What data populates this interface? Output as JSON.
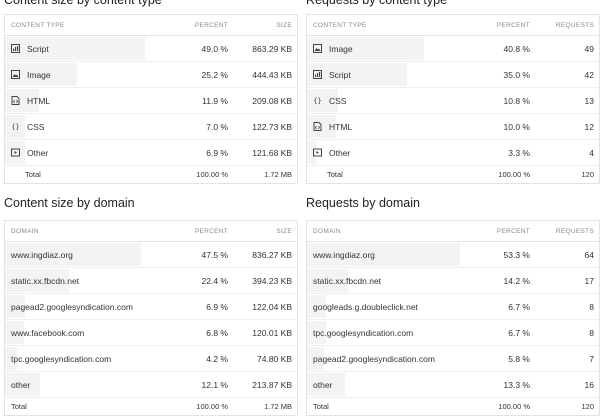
{
  "panels": [
    {
      "title": "Content size by content type",
      "headers": [
        "CONTENT TYPE",
        "PERCENT",
        "SIZE"
      ],
      "rows": [
        {
          "icon": "script-icon",
          "label": "Script",
          "percent": "49.0 %",
          "value": "863.29 KB",
          "share": 49.0
        },
        {
          "icon": "image-icon",
          "label": "Image",
          "percent": "25.2 %",
          "value": "444.43 KB",
          "share": 25.2
        },
        {
          "icon": "html-icon",
          "label": "HTML",
          "percent": "11.9 %",
          "value": "209.08 KB",
          "share": 11.9
        },
        {
          "icon": "css-icon",
          "label": "CSS",
          "percent": "7.0 %",
          "value": "122.73 KB",
          "share": 7.0
        },
        {
          "icon": "other-icon",
          "label": "Other",
          "percent": "6.9 %",
          "value": "121.68 KB",
          "share": 6.9
        }
      ],
      "total": {
        "label": "Total",
        "percent": "100.00 %",
        "value": "1.72 MB"
      }
    },
    {
      "title": "Requests by content type",
      "headers": [
        "CONTENT TYPE",
        "PERCENT",
        "REQUESTS"
      ],
      "rows": [
        {
          "icon": "image-icon",
          "label": "Image",
          "percent": "40.8 %",
          "value": "49",
          "share": 40.8
        },
        {
          "icon": "script-icon",
          "label": "Script",
          "percent": "35.0 %",
          "value": "42",
          "share": 35.0
        },
        {
          "icon": "css-icon",
          "label": "CSS",
          "percent": "10.8 %",
          "value": "13",
          "share": 10.8
        },
        {
          "icon": "html-icon",
          "label": "HTML",
          "percent": "10.0 %",
          "value": "12",
          "share": 10.0
        },
        {
          "icon": "other-icon",
          "label": "Other",
          "percent": "3.3 %",
          "value": "4",
          "share": 3.3
        }
      ],
      "total": {
        "label": "Total",
        "percent": "100.00 %",
        "value": "120"
      }
    },
    {
      "title": "Content size by domain",
      "headers": [
        "DOMAIN",
        "PERCENT",
        "SIZE"
      ],
      "rows": [
        {
          "label": "www.ingdiaz.org",
          "percent": "47.5 %",
          "value": "836.27 KB",
          "share": 47.5
        },
        {
          "label": "static.xx.fbcdn.net",
          "percent": "22.4 %",
          "value": "394.23 KB",
          "share": 22.4
        },
        {
          "label": "pagead2.googlesyndication.com",
          "percent": "6.9 %",
          "value": "122.04 KB",
          "share": 6.9
        },
        {
          "label": "www.facebook.com",
          "percent": "6.8 %",
          "value": "120.01 KB",
          "share": 6.8
        },
        {
          "label": "tpc.googlesyndication.com",
          "percent": "4.2 %",
          "value": "74.80 KB",
          "share": 4.2
        },
        {
          "label": "other",
          "percent": "12.1 %",
          "value": "213.87 KB",
          "share": 12.1
        }
      ],
      "total": {
        "label": "Total",
        "percent": "100.00 %",
        "value": "1.72 MB"
      }
    },
    {
      "title": "Requests by domain",
      "headers": [
        "DOMAIN",
        "PERCENT",
        "REQUESTS"
      ],
      "rows": [
        {
          "label": "www.ingdiaz.org",
          "percent": "53.3 %",
          "value": "64",
          "share": 53.3
        },
        {
          "label": "static.xx.fbcdn.net",
          "percent": "14.2 %",
          "value": "17",
          "share": 14.2
        },
        {
          "label": "googleads.g.doubleclick.net",
          "percent": "6.7 %",
          "value": "8",
          "share": 6.7
        },
        {
          "label": "tpc.googlesyndication.com",
          "percent": "6.7 %",
          "value": "8",
          "share": 6.7
        },
        {
          "label": "pagead2.googlesyndication.com",
          "percent": "5.8 %",
          "value": "7",
          "share": 5.8
        },
        {
          "label": "other",
          "percent": "13.3 %",
          "value": "16",
          "share": 13.3
        }
      ],
      "total": {
        "label": "Total",
        "percent": "100.00 %",
        "value": "120"
      }
    }
  ]
}
